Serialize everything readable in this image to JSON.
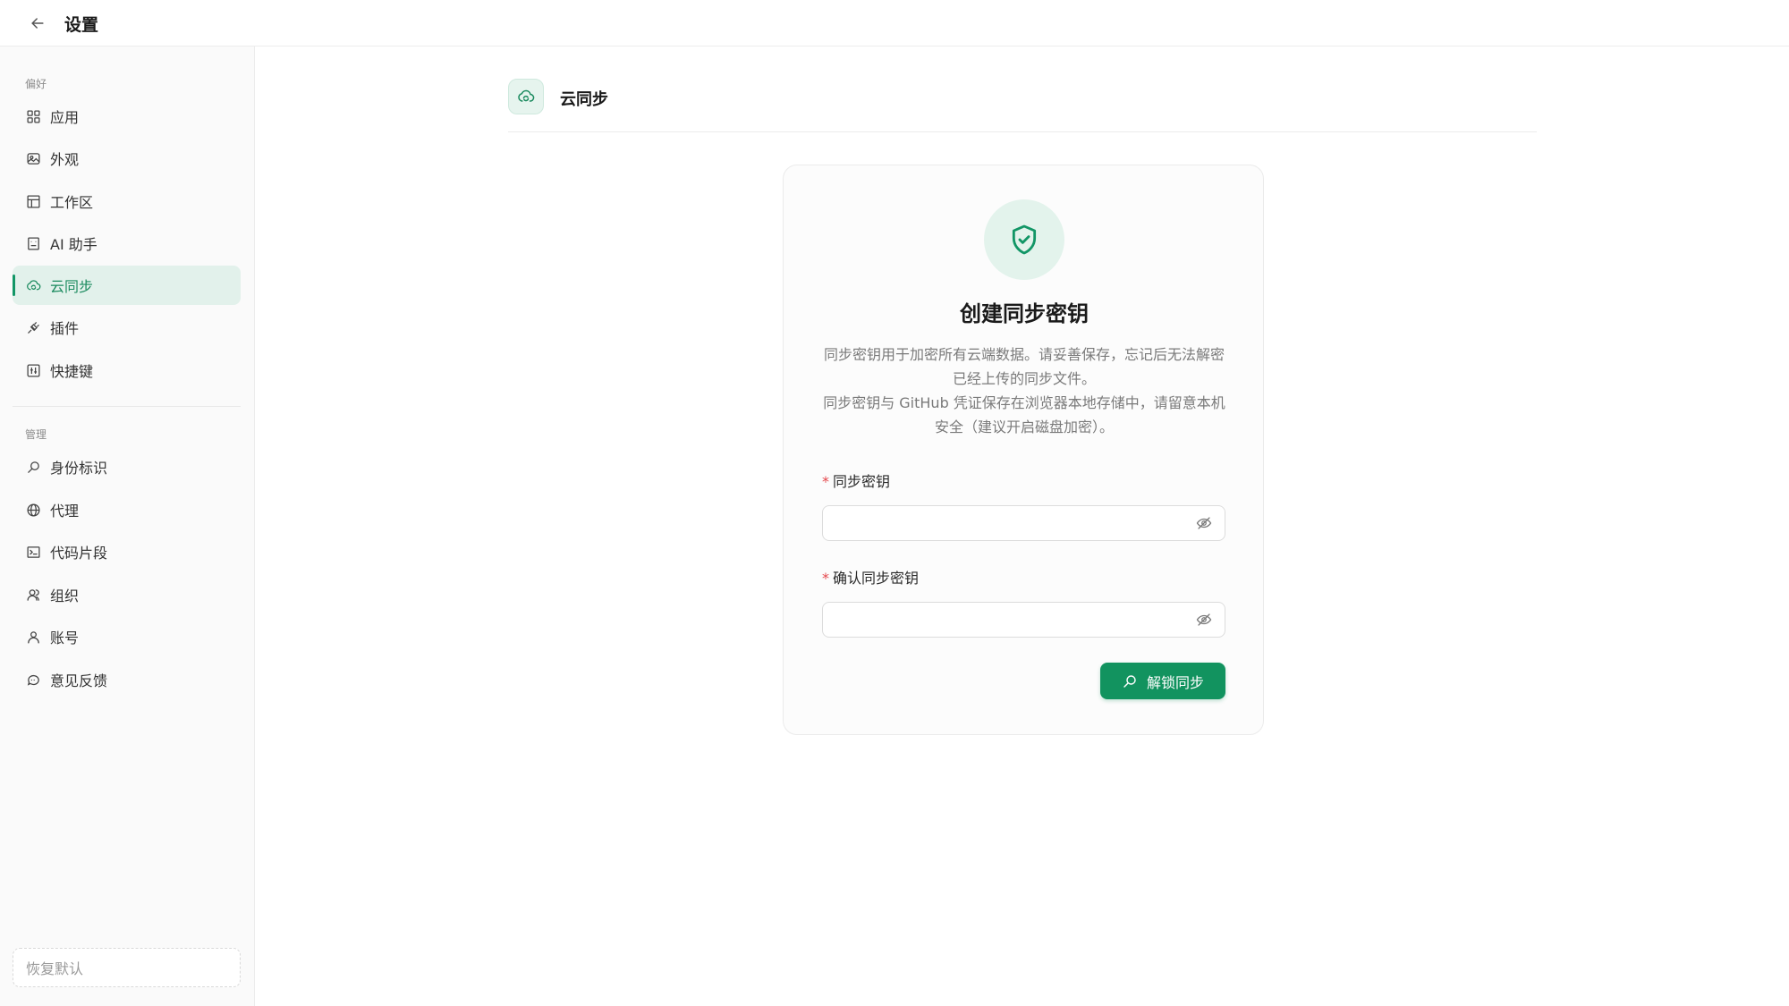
{
  "header": {
    "title": "设置"
  },
  "sidebar": {
    "groups": [
      {
        "label": "偏好"
      },
      {
        "label": "管理"
      }
    ],
    "items": [
      {
        "label": "应用",
        "icon": "grid-icon"
      },
      {
        "label": "外观",
        "icon": "image-icon"
      },
      {
        "label": "工作区",
        "icon": "layout-icon"
      },
      {
        "label": "AI 助手",
        "icon": "bot-icon"
      },
      {
        "label": "云同步",
        "icon": "cloud-sync-icon",
        "active": true
      },
      {
        "label": "插件",
        "icon": "plug-icon"
      },
      {
        "label": "快捷键",
        "icon": "shortcut-icon"
      },
      {
        "label": "身份标识",
        "icon": "key-search-icon"
      },
      {
        "label": "代理",
        "icon": "globe-icon"
      },
      {
        "label": "代码片段",
        "icon": "terminal-icon"
      },
      {
        "label": "组织",
        "icon": "users-icon"
      },
      {
        "label": "账号",
        "icon": "user-icon"
      },
      {
        "label": "意见反馈",
        "icon": "chat-icon"
      }
    ],
    "reset_label": "恢复默认"
  },
  "main": {
    "section_title": "云同步",
    "card": {
      "title": "创建同步密钥",
      "desc_line1": "同步密钥用于加密所有云端数据。请妥善保存，忘记后无法解密已经上传的同步文件。",
      "desc_line2": "同步密钥与 GitHub 凭证保存在浏览器本地存储中，请留意本机安全（建议开启磁盘加密）。",
      "field1": {
        "required_mark": "*",
        "label": "同步密钥",
        "value": ""
      },
      "field2": {
        "required_mark": "*",
        "label": "确认同步密钥",
        "value": ""
      },
      "submit_label": "解锁同步"
    }
  },
  "colors": {
    "accent": "#12935f",
    "active_bg": "#e2f1eb",
    "required": "#e5484d"
  }
}
